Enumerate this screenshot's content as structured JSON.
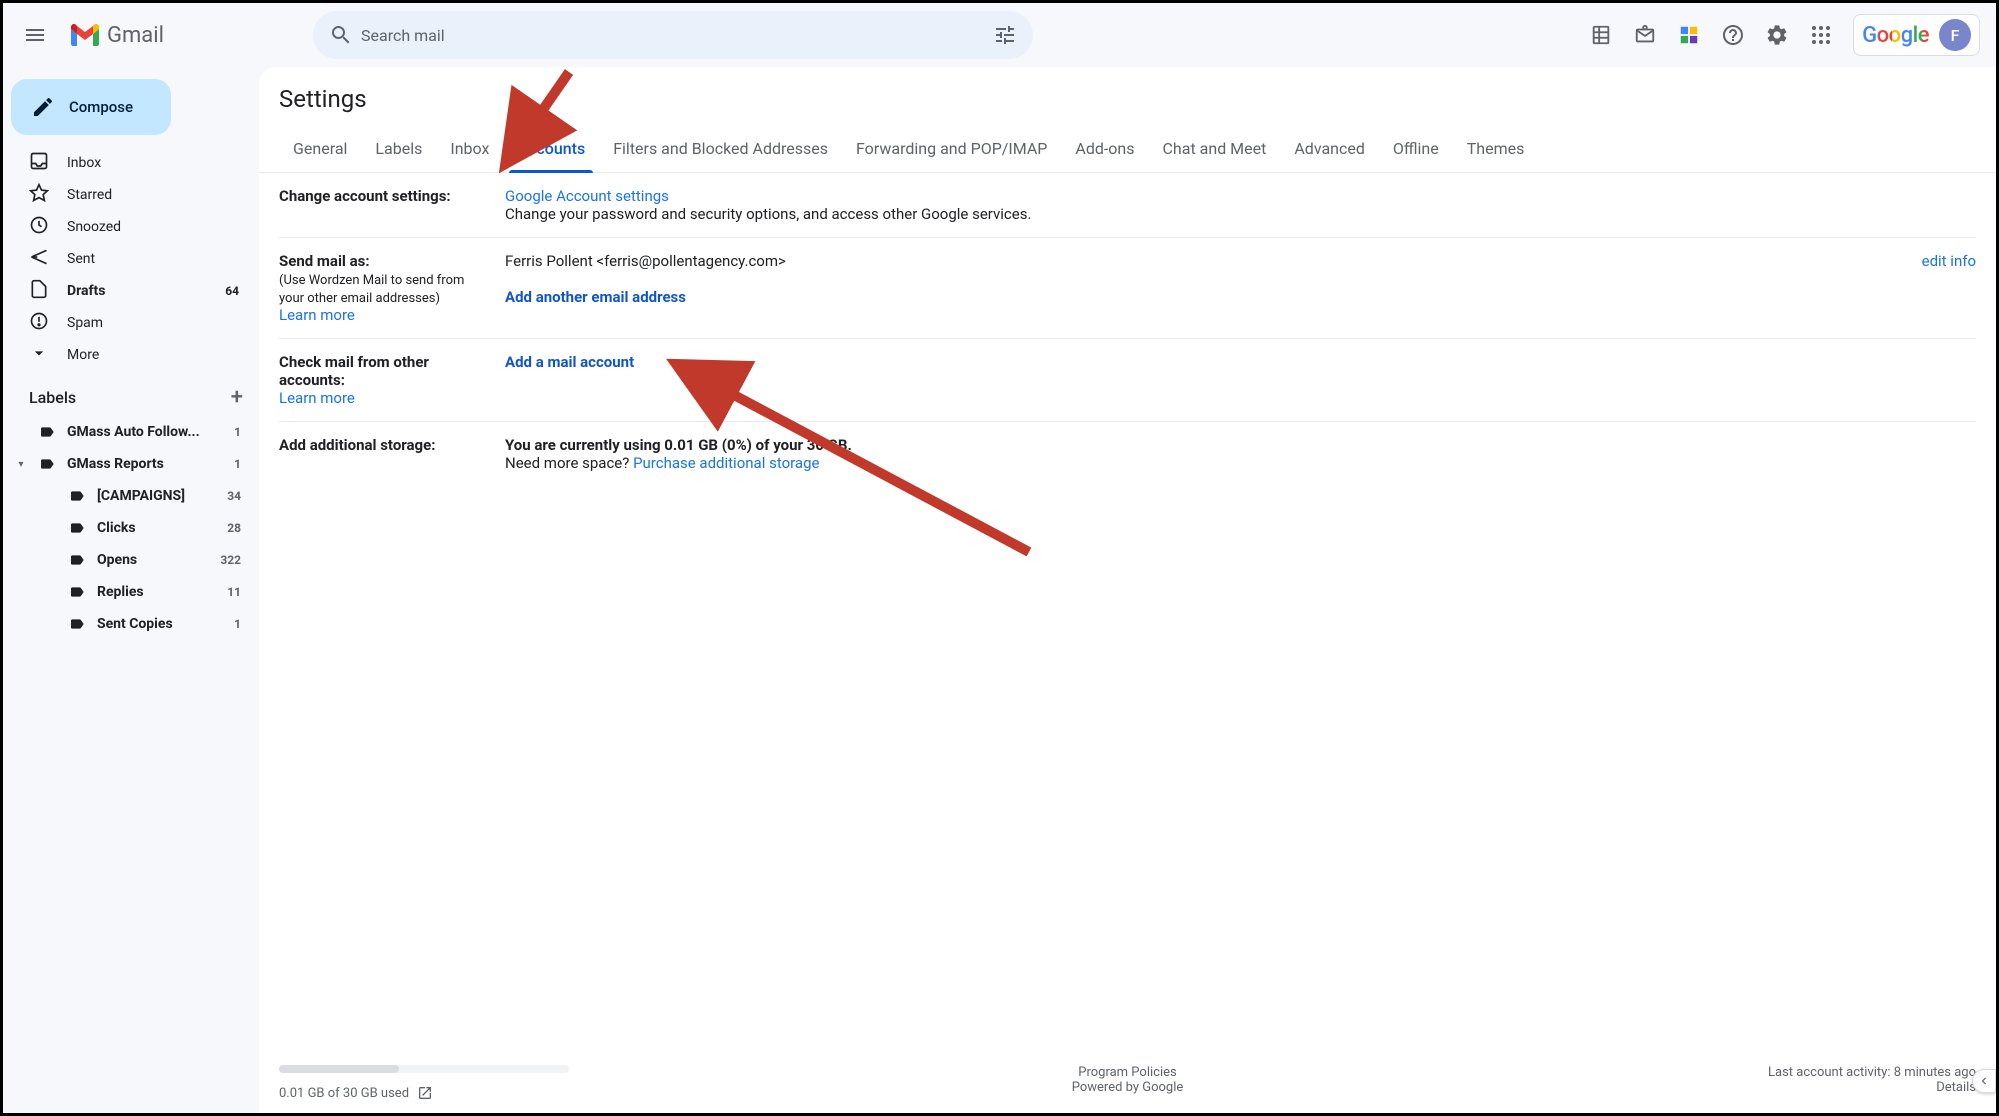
{
  "header": {
    "product": "Gmail",
    "search_placeholder": "Search mail",
    "google": "Google",
    "avatar_initial": "F"
  },
  "compose": "Compose",
  "nav": [
    {
      "icon": "inbox",
      "label": "Inbox",
      "count": "",
      "bold": false
    },
    {
      "icon": "star",
      "label": "Starred",
      "count": "",
      "bold": false
    },
    {
      "icon": "clock",
      "label": "Snoozed",
      "count": "",
      "bold": false
    },
    {
      "icon": "send",
      "label": "Sent",
      "count": "",
      "bold": false
    },
    {
      "icon": "file",
      "label": "Drafts",
      "count": "64",
      "bold": true
    },
    {
      "icon": "alert",
      "label": "Spam",
      "count": "",
      "bold": false
    },
    {
      "icon": "chevron",
      "label": "More",
      "count": "",
      "bold": false
    }
  ],
  "labels_header": "Labels",
  "labels": [
    {
      "label": "GMass Auto Follow...",
      "count": "1",
      "bold": true,
      "expand": "",
      "indent": 0
    },
    {
      "label": "GMass Reports",
      "count": "1",
      "bold": true,
      "expand": "▾",
      "indent": 0
    },
    {
      "label": "[CAMPAIGNS]",
      "count": "34",
      "bold": true,
      "expand": "",
      "indent": 1
    },
    {
      "label": "Clicks",
      "count": "28",
      "bold": true,
      "expand": "",
      "indent": 1
    },
    {
      "label": "Opens",
      "count": "322",
      "bold": true,
      "expand": "",
      "indent": 1
    },
    {
      "label": "Replies",
      "count": "11",
      "bold": true,
      "expand": "",
      "indent": 1
    },
    {
      "label": "Sent Copies",
      "count": "1",
      "bold": true,
      "expand": "",
      "indent": 1
    }
  ],
  "settings_title": "Settings",
  "tabs": [
    "General",
    "Labels",
    "Inbox",
    "Accounts",
    "Filters and Blocked Addresses",
    "Forwarding and POP/IMAP",
    "Add-ons",
    "Chat and Meet",
    "Advanced",
    "Offline",
    "Themes"
  ],
  "active_tab": 3,
  "sections": {
    "change": {
      "label": "Change account settings:",
      "link": "Google Account settings",
      "desc": "Change your password and security options, and access other Google services."
    },
    "sendas": {
      "label": "Send mail as:",
      "sub": "(Use Wordzen Mail to send from your other email addresses)",
      "learn": "Learn more",
      "identity": "Ferris Pollent <ferris@pollentagency.com>",
      "add": "Add another email address",
      "edit": "edit info"
    },
    "check": {
      "label": "Check mail from other accounts:",
      "learn": "Learn more",
      "add": "Add a mail account"
    },
    "storage": {
      "label": "Add additional storage:",
      "using": "You are currently using 0.01 GB (0%) of your 30 GB.",
      "need": "Need more space? ",
      "purchase": "Purchase additional storage"
    }
  },
  "footer": {
    "storage": "0.01 GB of 30 GB used",
    "policies": "Program Policies",
    "powered": "Powered by Google",
    "activity": "Last account activity: 8 minutes ago",
    "details": "Details"
  }
}
